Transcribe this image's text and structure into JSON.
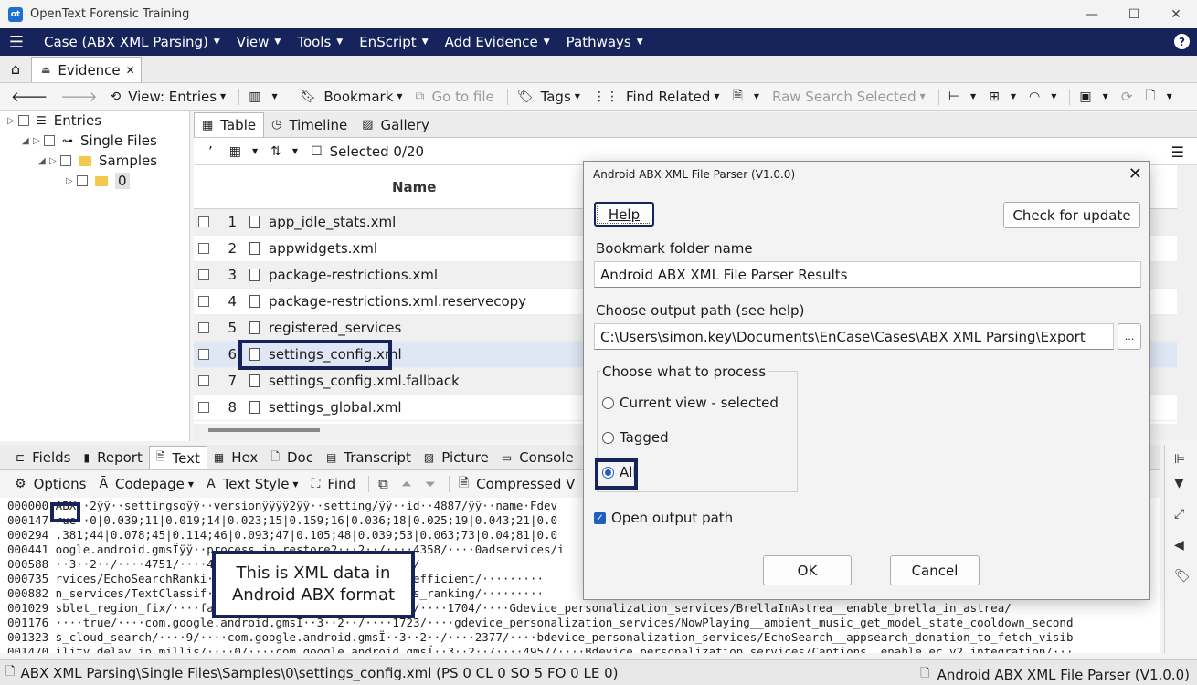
{
  "window": {
    "title": "OpenText Forensic Training"
  },
  "menu": {
    "items": [
      "Case (ABX XML Parsing)",
      "View",
      "Tools",
      "EnScript",
      "Add Evidence",
      "Pathways"
    ]
  },
  "tabs": {
    "evidence": "Evidence"
  },
  "toolbar": {
    "view": "View: Entries",
    "bookmark": "Bookmark",
    "goto": "Go to file",
    "tags": "Tags",
    "find_related": "Find Related",
    "raw_search": "Raw Search Selected"
  },
  "tree": {
    "entries": "Entries",
    "single_files": "Single Files",
    "samples": "Samples",
    "zero": "0"
  },
  "view_tabs": {
    "table": "Table",
    "timeline": "Timeline",
    "gallery": "Gallery"
  },
  "table": {
    "selected": "Selected 0/20",
    "name_header": "Name",
    "rows": [
      {
        "num": "1",
        "name": "app_idle_stats.xml"
      },
      {
        "num": "2",
        "name": "appwidgets.xml"
      },
      {
        "num": "3",
        "name": "package-restrictions.xml"
      },
      {
        "num": "4",
        "name": "package-restrictions.xml.reservecopy"
      },
      {
        "num": "5",
        "name": "registered_services"
      },
      {
        "num": "6",
        "name": "settings_config.xml"
      },
      {
        "num": "7",
        "name": "settings_config.xml.fallback"
      },
      {
        "num": "8",
        "name": "settings_global.xml"
      }
    ]
  },
  "bottom_tabs": {
    "fields": "Fields",
    "report": "Report",
    "text": "Text",
    "hex": "Hex",
    "doc": "Doc",
    "transcript": "Transcript",
    "picture": "Picture",
    "console": "Console"
  },
  "bottom_toolbar": {
    "options": "Options",
    "codepage": "Codepage",
    "text_style": "Text Style",
    "find": "Find",
    "compressed": "Compressed V"
  },
  "hex": {
    "lines": [
      "000000 ABX ·2ÿÿ··settingsoÿÿ··versionÿÿÿÿ2ÿÿ··setting/ÿÿ··id··4887/ÿÿ··name·Fdev",
      "000147 rue··0|0.039;11|0.019;14|0.023;15|0.159;16|0.036;18|0.025;19|0.043;21|0.0",
      "000294 .381;44|0.078;45|0.114;46|0.093;47|0.105;48|0.039;53|0.063;73|0.04;81|0.0",
      "000441 oogle.android.gmsÏÿÿ··process_in_restore2···2··/····4358/····0adservices/i",
      "000588 ··3··2··/····4751/····4······ersisted_per_app/····20/",
      "000735 rvices/EchoSearchRanki·····················corpus_coefficient/·········",
      "000882 n_services/TextClassif·····················kg_actions_ranking/·········",
      "001029 sblet_region_fix/····fa··················msÏ··3··2··/····1704/····Gdevice_personalization_services/BrellaInAstrea__enable_brella_in_astrea/",
      "001176 ····true/····com.google.android.gmsÏ··3··2··/····1723/····gdevice_personalization_services/NowPlaying__ambient_music_get_model_state_cooldown_second",
      "001323 s_cloud_search/····9/····com.google.android.gmsÏ··3··2··/····2377/····bdevice_personalization_services/EchoSearch__appsearch_donation_to_fetch_visib",
      "001470 ility_delay_in_millis/····0/····com.google.android.gmsÏ··3··2··/····4957/····Bdevice_personalization_services/Captions__enable_ec_v2_integration/···"
    ]
  },
  "callout": {
    "line1": "This is XML data in",
    "line2": "Android ABX format"
  },
  "status": {
    "path": "ABX XML Parsing\\Single Files\\Samples\\0\\settings_config.xml (PS 0 CL 0 SO 5 FO 0 LE 0)",
    "right": "Android ABX XML File Parser (V1.0.0)"
  },
  "dialog": {
    "title": "Android ABX XML File Parser (V1.0.0)",
    "help": "Help",
    "check_update": "Check for update",
    "bookmark_label": "Bookmark folder name",
    "bookmark_value": "Android ABX XML File Parser Results",
    "output_label": "Choose output path (see help)",
    "output_value": "C:\\Users\\simon.key\\Documents\\EnCase\\Cases\\ABX XML Parsing\\Export",
    "browse": "...",
    "process_legend": "Choose what to process",
    "opt_current": "Current view - selected",
    "opt_tagged": "Tagged",
    "opt_all": "All",
    "open_output": "Open output path",
    "ok": "OK",
    "cancel": "Cancel"
  }
}
